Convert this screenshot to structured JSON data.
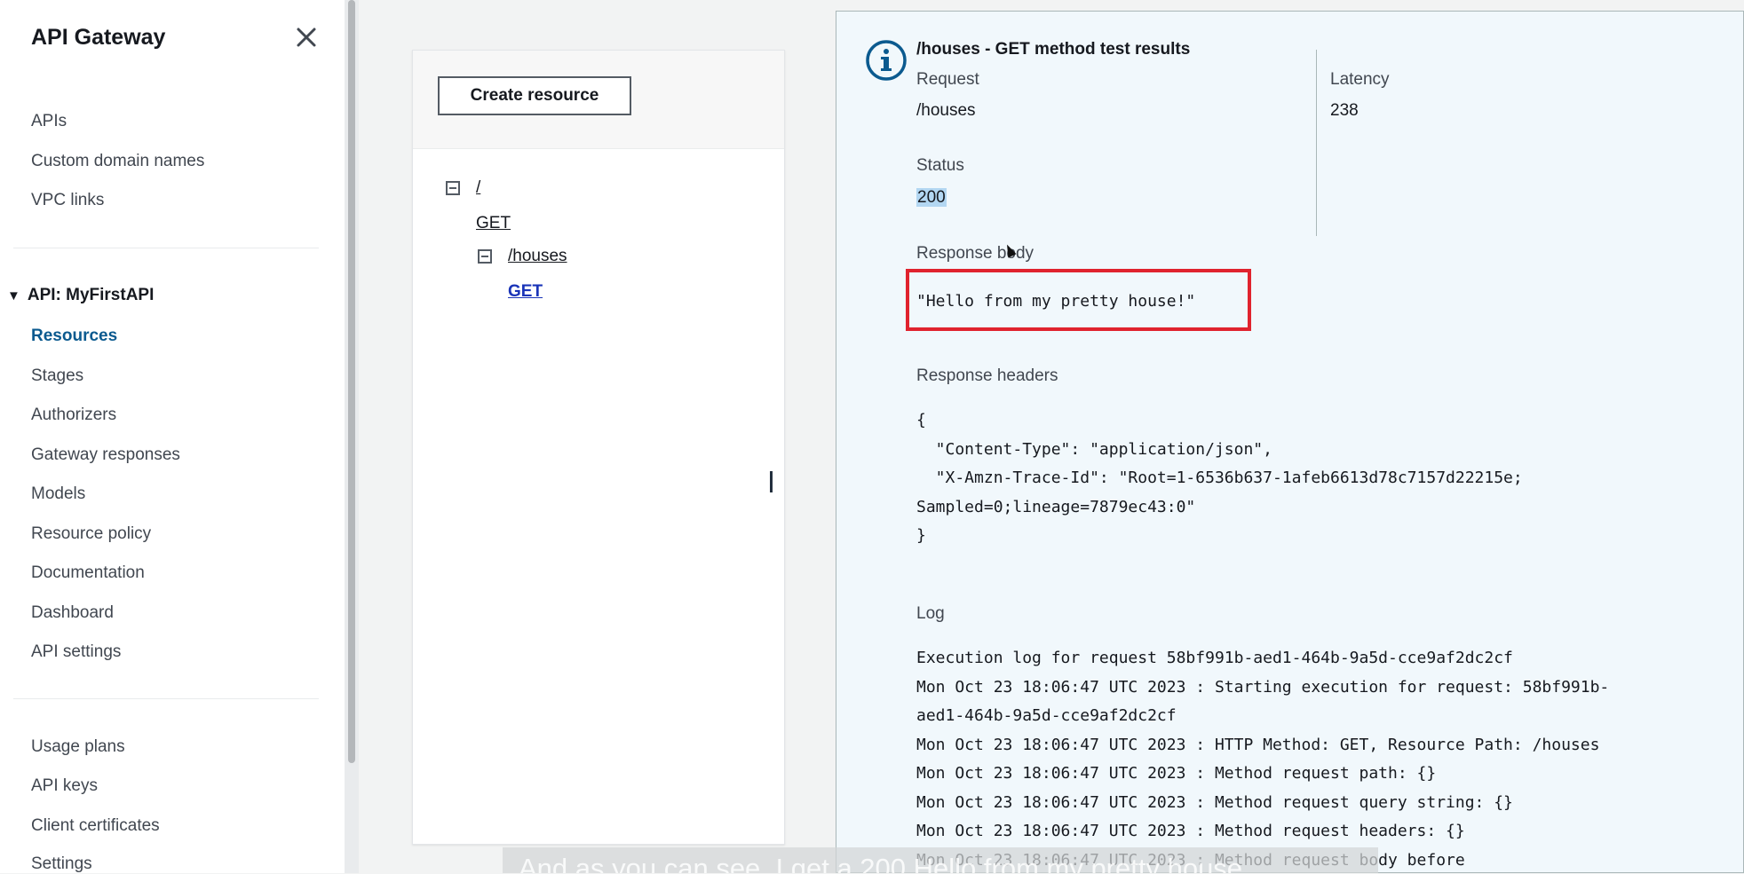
{
  "sidebar": {
    "title": "API Gateway",
    "top_items": [
      {
        "label": "APIs"
      },
      {
        "label": "Custom domain names"
      },
      {
        "label": "VPC links"
      }
    ],
    "section": {
      "label": "API: MyFirstAPI",
      "expanded": true
    },
    "api_items": [
      {
        "label": "Resources",
        "active": true
      },
      {
        "label": "Stages"
      },
      {
        "label": "Authorizers"
      },
      {
        "label": "Gateway responses"
      },
      {
        "label": "Models"
      },
      {
        "label": "Resource policy"
      },
      {
        "label": "Documentation"
      },
      {
        "label": "Dashboard"
      },
      {
        "label": "API settings"
      }
    ],
    "bottom_items": [
      {
        "label": "Usage plans"
      },
      {
        "label": "API keys"
      },
      {
        "label": "Client certificates"
      },
      {
        "label": "Settings"
      }
    ]
  },
  "resources": {
    "create_button": "Create resource",
    "tree": [
      {
        "label": "/",
        "type": "resource"
      },
      {
        "label": "GET",
        "type": "method"
      },
      {
        "label": "/houses",
        "type": "resource"
      },
      {
        "label": "GET",
        "type": "method",
        "selected": true
      }
    ]
  },
  "results": {
    "title": "/houses - GET method test results",
    "request_label": "Request",
    "request_value": "/houses",
    "latency_label": "Latency",
    "latency_value": "238",
    "status_label": "Status",
    "status_value": "200",
    "response_body_label": "Response body",
    "response_body": "\"Hello from my pretty house!\"",
    "response_headers_label": "Response headers",
    "response_headers_lines": [
      "{",
      "  \"Content-Type\": \"application/json\",",
      "  \"X-Amzn-Trace-Id\": \"Root=1-6536b637-1afeb6613d78c7157d22215e;",
      "Sampled=0;lineage=7879ec43:0\"",
      "}"
    ],
    "log_label": "Log",
    "log_lines": [
      "Execution log for request 58bf991b-aed1-464b-9a5d-cce9af2dc2cf",
      "Mon Oct 23 18:06:47 UTC 2023 : Starting execution for request: 58bf991b-",
      "aed1-464b-9a5d-cce9af2dc2cf",
      "Mon Oct 23 18:06:47 UTC 2023 : HTTP Method: GET, Resource Path: /houses",
      "Mon Oct 23 18:06:47 UTC 2023 : Method request path: {}",
      "Mon Oct 23 18:06:47 UTC 2023 : Method request query string: {}",
      "Mon Oct 23 18:06:47 UTC 2023 : Method request headers: {}",
      "Mon Oct 23 18:06:47 UTC 2023 : Method request body before"
    ]
  },
  "caption": {
    "text": "And as you can see, I get a 200 Hello from my pretty house"
  },
  "colors": {
    "accent_link": "#0b5a8f",
    "selected_method": "#1a34b8",
    "highlight_box": "#e0232e",
    "info_panel_bg": "#f1f8fc"
  }
}
